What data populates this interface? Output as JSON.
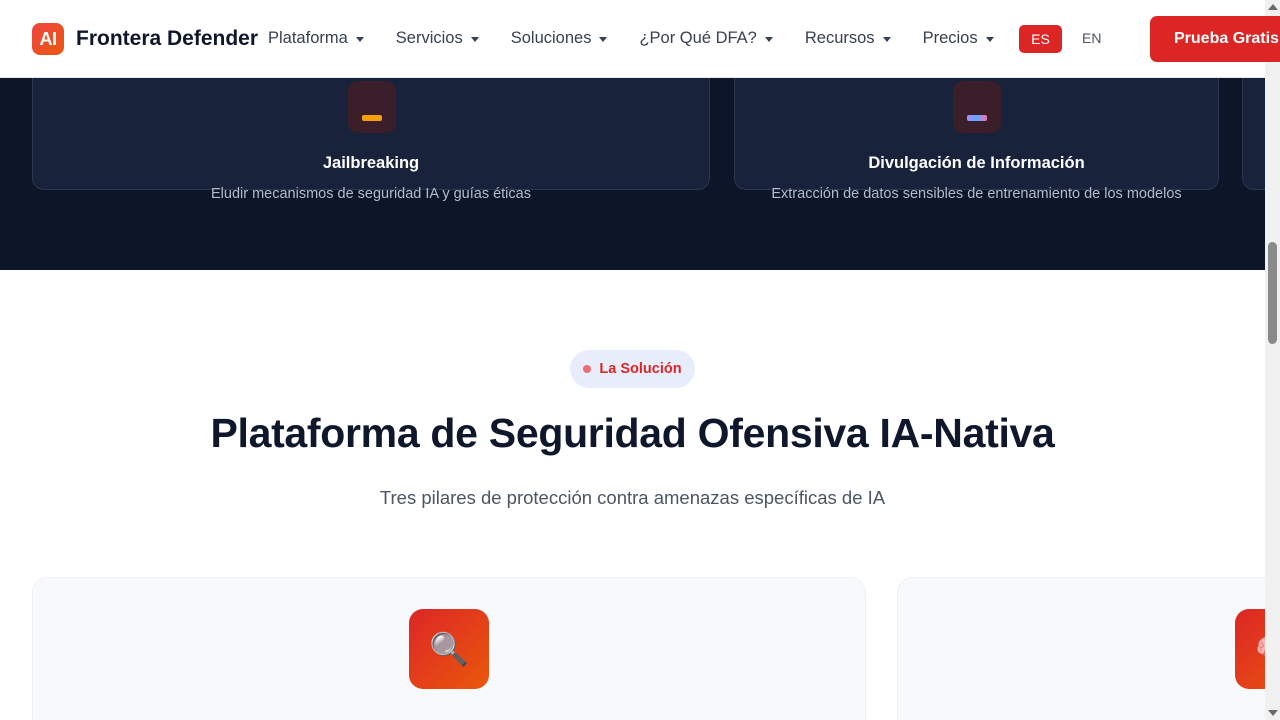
{
  "header": {
    "logo_text": "AI",
    "brand": "Frontera Defender",
    "nav": [
      {
        "label": "Plataforma"
      },
      {
        "label": "Servicios"
      },
      {
        "label": "Soluciones"
      },
      {
        "label": "¿Por Qué DFA?"
      },
      {
        "label": "Recursos"
      },
      {
        "label": "Precios"
      }
    ],
    "lang_active": "ES",
    "lang_other": "EN",
    "cta": "Prueba Gratis"
  },
  "threats": [
    {
      "title": "Jailbreaking",
      "description": "Eludir mecanismos de seguridad IA y guías éticas",
      "icon": "warning-icon"
    },
    {
      "title": "Divulgación de Información",
      "description": "Extracción de datos sensibles de entrenamiento de los modelos",
      "icon": "data-icon"
    }
  ],
  "solution": {
    "badge": "La Solución",
    "title": "Plataforma de Seguridad Ofensiva IA-Nativa",
    "subtitle": "Tres pilares de protección contra amenazas específicas de IA",
    "pillars": [
      {
        "icon": "magnifier-icon",
        "glyph": "🔍"
      },
      {
        "icon": "brain-icon",
        "glyph": "🧠"
      }
    ]
  },
  "colors": {
    "accent": "#dc2626",
    "dark_bg": "#0c1628",
    "card_bg": "#18223a"
  }
}
